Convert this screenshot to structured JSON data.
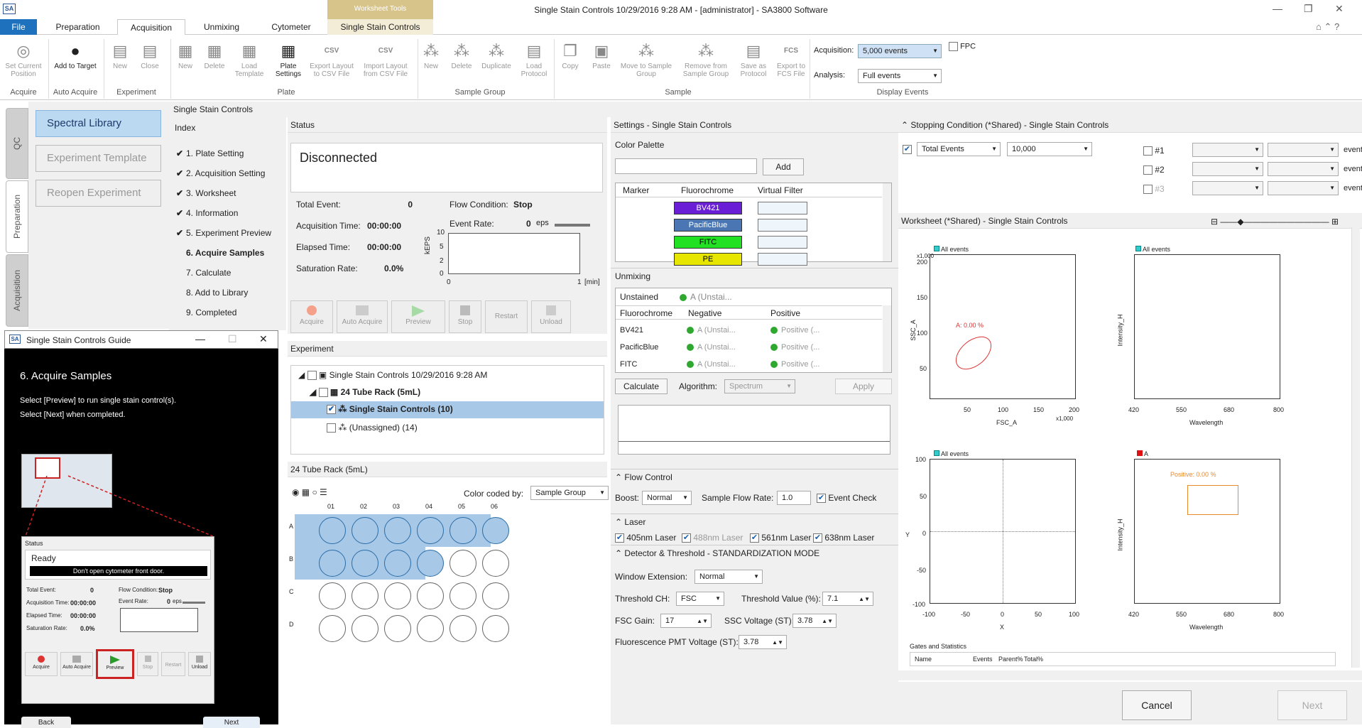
{
  "window": {
    "title": "Single Stain Controls 10/29/2016 9:28 AM - [administrator] - SA3800 Software",
    "logo": "SA",
    "contextual_tab_group": "Worksheet Tools"
  },
  "tabs": [
    {
      "label": "File"
    },
    {
      "label": "Preparation"
    },
    {
      "label": "Acquisition"
    },
    {
      "label": "Unmixing"
    },
    {
      "label": "Cytometer"
    },
    {
      "label": "Single Stain Controls"
    }
  ],
  "ribbon": {
    "acquire": {
      "set_current": "Set Current Position",
      "group": "Acquire"
    },
    "auto": {
      "add": "Add to Target",
      "group": "Auto Acquire"
    },
    "experiment": {
      "new": "New",
      "close": "Close",
      "group": "Experiment"
    },
    "plate": {
      "new": "New",
      "delete": "Delete",
      "load": "Load Template",
      "settings": "Plate Settings",
      "export": "Export Layout to CSV File",
      "import": "Import Layout from CSV File",
      "group": "Plate"
    },
    "sample_group": {
      "new": "New",
      "delete": "Delete",
      "duplicate": "Duplicate",
      "load": "Load Protocol",
      "group": "Sample Group"
    },
    "sample": {
      "copy": "Copy",
      "paste": "Paste",
      "move": "Move to Sample Group",
      "remove": "Remove from Sample Group",
      "save": "Save as Protocol",
      "export": "Export to FCS File",
      "group": "Sample",
      "csv": "CSV",
      "fcs": "FCS"
    },
    "display": {
      "acq_label": "Acquisition:",
      "acq_value": "5,000 events",
      "ana_label": "Analysis:",
      "ana_value": "Full events",
      "fpc": "FPC",
      "group": "Display Events"
    }
  },
  "side_tabs": [
    "QC",
    "Preparation",
    "Acquisition"
  ],
  "left_buttons": [
    "Spectral Library",
    "Experiment Template",
    "Reopen Experiment"
  ],
  "main_header": "Single Stain Controls",
  "index": {
    "title": "Index",
    "steps": [
      {
        "label": "1. Plate Setting",
        "done": "✔"
      },
      {
        "label": "2. Acquisition Setting",
        "done": "✔"
      },
      {
        "label": "3. Worksheet",
        "done": "✔"
      },
      {
        "label": "4. Information",
        "done": "✔"
      },
      {
        "label": "5. Experiment Preview",
        "done": "✔"
      },
      {
        "label": "6. Acquire Samples",
        "done": ""
      },
      {
        "label": "7. Calculate",
        "done": ""
      },
      {
        "label": "8. Add to Library",
        "done": ""
      },
      {
        "label": "9. Completed",
        "done": ""
      }
    ]
  },
  "status": {
    "title": "Status",
    "state": "Disconnected",
    "total_event_label": "Total Event:",
    "total_event": "0",
    "acq_time_label": "Acquisition Time:",
    "acq_time": "00:00:00",
    "elapsed_label": "Elapsed Time:",
    "elapsed": "00:00:00",
    "saturation_label": "Saturation Rate:",
    "saturation": "0.0%",
    "flow_label": "Flow Condition:",
    "flow": "Stop",
    "rate_label": "Event Rate:",
    "rate": "0",
    "rate_unit": "eps",
    "yaxis": "kEPS",
    "yticks": [
      "10",
      "5",
      "2",
      "0"
    ],
    "xticks": [
      "0",
      "1"
    ],
    "xunit": "[min]",
    "buttons": [
      "Acquire",
      "Auto Acquire",
      "Preview",
      "Stop",
      "Restart",
      "Unload"
    ]
  },
  "experiment": {
    "title": "Experiment",
    "items": [
      "Single Stain Controls 10/29/2016 9:28 AM",
      "24 Tube Rack (5mL)",
      "Single Stain Controls (10)",
      "(Unassigned) (14)"
    ]
  },
  "rack": {
    "title": "24 Tube Rack (5mL)",
    "color_label": "Color coded by:",
    "color_value": "Sample Group",
    "cols": [
      "01",
      "02",
      "03",
      "04",
      "05",
      "06"
    ],
    "rows": [
      "A",
      "B",
      "C",
      "D"
    ]
  },
  "settings": {
    "title": "Settings - Single Stain Controls",
    "palette_title": "Color Palette",
    "add": "Add",
    "table_headers": [
      "Marker",
      "Fluorochrome",
      "Virtual Filter"
    ],
    "fluors": [
      {
        "name": "BV421",
        "color": "#6a1fd6"
      },
      {
        "name": "PacificBlue",
        "color": "#4a77b4"
      },
      {
        "name": "FITC",
        "color": "#22e022"
      },
      {
        "name": "PE",
        "color": "#e6e600"
      }
    ],
    "unmixing_title": "Unmixing",
    "unstained_label": "Unstained",
    "unstained_value": "A (Unstai...",
    "unmix_headers": [
      "Fluorochrome",
      "Negative",
      "Positive"
    ],
    "unmix_rows": [
      {
        "f": "BV421",
        "n": "A (Unstai...",
        "p": "Positive (..."
      },
      {
        "f": "PacificBlue",
        "n": "A (Unstai...",
        "p": "Positive (..."
      },
      {
        "f": "FITC",
        "n": "A (Unstai...",
        "p": "Positive (..."
      }
    ],
    "calculate": "Calculate",
    "algorithm_label": "Algorithm:",
    "algorithm": "Spectrum",
    "apply": "Apply",
    "flow_control": "Flow Control",
    "boost_label": "Boost:",
    "boost": "Normal",
    "flow_rate_label": "Sample Flow Rate:",
    "flow_rate": "1.0",
    "event_check": "Event Check",
    "laser": "Laser",
    "lasers": [
      "405nm Laser",
      "488nm Laser",
      "561nm Laser",
      "638nm Laser"
    ],
    "detector": "Detector & Threshold - STANDARDIZATION MODE",
    "window_ext_label": "Window Extension:",
    "window_ext": "Normal",
    "threshold_ch_label": "Threshold CH:",
    "threshold_ch": "FSC",
    "threshold_val_label": "Threshold Value (%):",
    "threshold_val": "7.1",
    "fsc_gain_label": "FSC Gain:",
    "fsc_gain": "17",
    "ssc_label": "SSC Voltage (ST):",
    "ssc": "3.78",
    "pmt_label": "Fluorescence PMT Voltage (ST):",
    "pmt": "3.78"
  },
  "stopping": {
    "title": "Stopping Condition (*Shared) - Single Stain Controls",
    "type": "Total Events",
    "value": "10,000",
    "rows": [
      "#1",
      "#2",
      "#3"
    ],
    "unit": "events"
  },
  "worksheet": {
    "title": "Worksheet (*Shared) - Single Stain Controls",
    "plot1": {
      "gate": "All events",
      "xlabel": "FSC_A",
      "ylabel": "SSC_A",
      "xticks": [
        "50",
        "100",
        "150",
        "200"
      ],
      "yticks": [
        "200",
        "150",
        "100",
        "50"
      ],
      "scale": "x1,000",
      "region": "A: 0.00 %"
    },
    "plot2": {
      "gate": "All events",
      "xlabel": "Wavelength",
      "ylabel": "Intensity_H",
      "xticks": [
        "420",
        "550",
        "680",
        "800"
      ]
    },
    "plot3": {
      "gate": "All events",
      "xlabel": "X",
      "ylabel": "Y",
      "xticks": [
        "-100",
        "-50",
        "0",
        "50",
        "100"
      ],
      "yticks": [
        "100",
        "50",
        "0",
        "-50",
        "-100"
      ]
    },
    "plot4": {
      "gate": "A",
      "xlabel": "Wavelength",
      "ylabel": "Intensity_H",
      "xticks": [
        "420",
        "550",
        "680",
        "800"
      ],
      "region": "Positive: 0.00 %"
    },
    "stats_title": "Gates and Statistics",
    "stats_headers": [
      "Name",
      "Events",
      "Parent%",
      "Total%"
    ]
  },
  "footer": {
    "cancel": "Cancel",
    "next": "Next"
  },
  "guide": {
    "title": "Single Stain Controls Guide",
    "heading": "6. Acquire Samples",
    "line1": "Select [Preview] to run single stain control(s).",
    "line2": "Select [Next] when completed.",
    "mini_title": "Status",
    "mini_state": "Ready",
    "mini_warn": "Don't open cytometer front door.",
    "mini_total": "Total Event:",
    "mini_total_v": "0",
    "mini_flow": "Flow Condition:",
    "mini_flow_v": "Stop",
    "mini_acq": "Acquisition Time:",
    "mini_acq_v": "00:00:00",
    "mini_rate": "Event Rate:",
    "mini_rate_v": "0",
    "mini_rate_u": "eps",
    "mini_el": "Elapsed Time:",
    "mini_el_v": "00:00:00",
    "mini_sat": "Saturation Rate:",
    "mini_sat_v": "0.0%",
    "mini_btns": [
      "Acquire",
      "Auto Acquire",
      "Preview",
      "Stop",
      "Restart",
      "Unload"
    ],
    "back": "Back",
    "next": "Next"
  }
}
